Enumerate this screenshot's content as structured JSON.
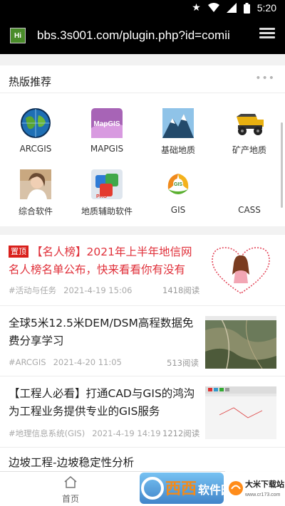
{
  "status": {
    "time": "5:20"
  },
  "browser": {
    "site_icon": "Hi",
    "url": "bbs.3s001.com/plugin.php?id=comii"
  },
  "hot": {
    "title": "热版推荐",
    "more": "•••",
    "items": [
      {
        "label": "ARCGIS",
        "icon": "globe-icon"
      },
      {
        "label": "MAPGIS",
        "icon": "mapgis-icon"
      },
      {
        "label": "基础地质",
        "icon": "mountain-icon"
      },
      {
        "label": "矿产地质",
        "icon": "dump-truck-icon"
      },
      {
        "label": "综合软件",
        "icon": "photo-icon"
      },
      {
        "label": "地质辅助软件",
        "icon": "office-icon"
      },
      {
        "label": "GIS",
        "icon": "gis-leaf-icon"
      },
      {
        "label": "CASS",
        "icon": ""
      }
    ]
  },
  "news": [
    {
      "badge": "置顶",
      "title": "【名人榜】2021年上半年地信网名人榜名单公布，快来看看你有没有",
      "tag": "#活动与任务",
      "date": "2021-4-19 15:06",
      "reads": "1418阅读"
    },
    {
      "badge": "",
      "title": "全球5米12.5米DEM/DSM高程数据免费分享学习",
      "tag": "#ARCGIS",
      "date": "2021-4-20 11:05",
      "reads": "513阅读"
    },
    {
      "badge": "",
      "title": "【工程人必看】打通CAD与GIS的鸿沟为工程业务提供专业的GIS服务",
      "tag": "#地理信息系统(GIS)",
      "date": "2021-4-19 14:19",
      "reads": "1212阅读"
    },
    {
      "badge": "",
      "title": "边坡工程-边坡稳定性分析",
      "tag": "",
      "date": "",
      "reads": ""
    }
  ],
  "bottom": {
    "home_label": "首页"
  },
  "watermark": {
    "text1": "西西",
    "text2": "软件园",
    "text3": "大米下载站",
    "text4": "www.cr173.com"
  }
}
